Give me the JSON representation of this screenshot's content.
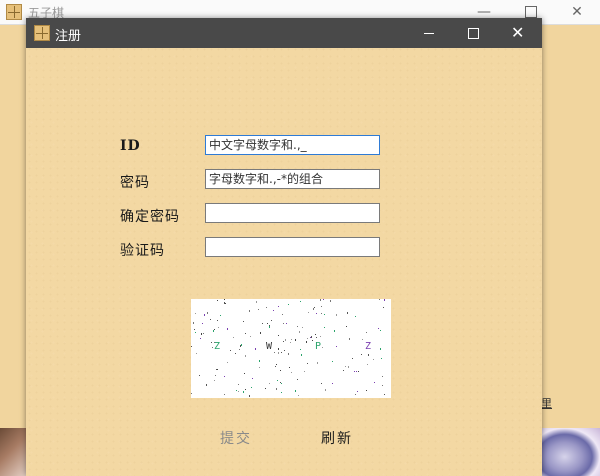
{
  "background_window": {
    "title": "五子棋",
    "link_text": "里"
  },
  "dialog": {
    "title": "注册",
    "fields": [
      {
        "label": "ID",
        "value": "",
        "placeholder": "中文字母数字和.,_"
      },
      {
        "label": "密码",
        "value": "",
        "placeholder": "字母数字和.,-*的组合"
      },
      {
        "label": "确定密码",
        "value": "",
        "placeholder": ""
      },
      {
        "label": "验证码",
        "value": "",
        "placeholder": ""
      }
    ],
    "captcha": {
      "chars": [
        "Z",
        "W",
        "P",
        "Z"
      ],
      "colors": [
        "#2aa36b",
        "#333333",
        "#2aa36b",
        "#7a3fb0"
      ]
    },
    "buttons": {
      "submit": "提交",
      "refresh": "刷新"
    }
  },
  "colors": {
    "dialog_titlebar": "#494949",
    "dialog_background": "#f3d8a3",
    "focus_border": "#2f7bd5"
  }
}
